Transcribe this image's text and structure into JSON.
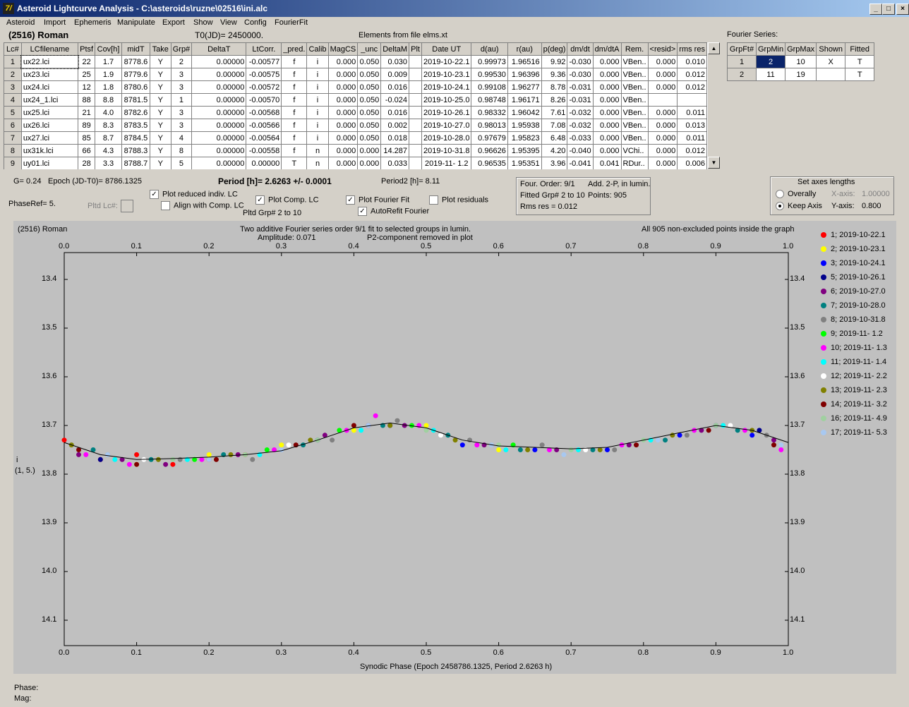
{
  "window": {
    "title": "Asteroid Lightcurve Analysis - C:\\asteroids\\ruzne\\02516\\ini.alc",
    "icon_label": "7/"
  },
  "menu": [
    "Asteroid",
    "Import",
    "Ephemeris",
    "Manipulate",
    "Export",
    "Show",
    "View",
    "Config",
    "FourierFit"
  ],
  "header": {
    "asteroid": "(2516) Roman",
    "t0": "T0(JD)= 2450000.",
    "elements": "Elements from file elms.xt",
    "fourier_title": "Fourier Series:"
  },
  "lc_table": {
    "columns": [
      "Lc#",
      "LCfilename",
      "Ptsf",
      "Cov[h]",
      "midT",
      "Take",
      "Grp#",
      "DeltaT",
      "LtCorr.",
      "_pred.",
      "Calib",
      "MagCS",
      "_unc",
      "DeltaM",
      "Plt",
      "Date UT",
      "d(au)",
      "r(au)",
      "p(deg)",
      "dm/dt",
      "dm/dtA",
      "Rem.",
      "<resid>",
      "rms res"
    ],
    "rows": [
      [
        "1",
        "ux22.lci",
        "22",
        "1.7",
        "8778.6",
        "Y",
        "2",
        "0.00000",
        "-0.00577",
        "f",
        "i",
        "0.000",
        "0.050",
        "0.030",
        "",
        "2019-10-22.1",
        "0.99973",
        "1.96516",
        "9.92",
        "-0.030",
        "0.000",
        "VBen..",
        "0.000",
        "0.010"
      ],
      [
        "2",
        "ux23.lci",
        "25",
        "1.9",
        "8779.6",
        "Y",
        "3",
        "0.00000",
        "-0.00575",
        "f",
        "i",
        "0.000",
        "0.050",
        "0.009",
        "",
        "2019-10-23.1",
        "0.99530",
        "1.96396",
        "9.36",
        "-0.030",
        "0.000",
        "VBen..",
        "0.000",
        "0.012"
      ],
      [
        "3",
        "ux24.lci",
        "12",
        "1.8",
        "8780.6",
        "Y",
        "3",
        "0.00000",
        "-0.00572",
        "f",
        "i",
        "0.000",
        "0.050",
        "0.016",
        "",
        "2019-10-24.1",
        "0.99108",
        "1.96277",
        "8.78",
        "-0.031",
        "0.000",
        "VBen..",
        "0.000",
        "0.012"
      ],
      [
        "4",
        "ux24_1.lci",
        "88",
        "8.8",
        "8781.5",
        "Y",
        "1",
        "0.00000",
        "-0.00570",
        "f",
        "i",
        "0.000",
        "0.050",
        "-0.024",
        "",
        "2019-10-25.0",
        "0.98748",
        "1.96171",
        "8.26",
        "-0.031",
        "0.000",
        "VBen..",
        "",
        ""
      ],
      [
        "5",
        "ux25.lci",
        "21",
        "4.0",
        "8782.6",
        "Y",
        "3",
        "0.00000",
        "-0.00568",
        "f",
        "i",
        "0.000",
        "0.050",
        "0.016",
        "",
        "2019-10-26.1",
        "0.98332",
        "1.96042",
        "7.61",
        "-0.032",
        "0.000",
        "VBen..",
        "0.000",
        "0.011"
      ],
      [
        "6",
        "ux26.lci",
        "89",
        "8.3",
        "8783.5",
        "Y",
        "3",
        "0.00000",
        "-0.00566",
        "f",
        "i",
        "0.000",
        "0.050",
        "0.002",
        "",
        "2019-10-27.0",
        "0.98013",
        "1.95938",
        "7.08",
        "-0.032",
        "0.000",
        "VBen..",
        "0.000",
        "0.013"
      ],
      [
        "7",
        "ux27.lci",
        "85",
        "8.7",
        "8784.5",
        "Y",
        "4",
        "0.00000",
        "-0.00564",
        "f",
        "i",
        "0.000",
        "0.050",
        "0.018",
        "",
        "2019-10-28.0",
        "0.97679",
        "1.95823",
        "6.48",
        "-0.033",
        "0.000",
        "VBen..",
        "0.000",
        "0.011"
      ],
      [
        "8",
        "ux31k.lci",
        "66",
        "4.3",
        "8788.3",
        "Y",
        "8",
        "0.00000",
        "-0.00558",
        "f",
        "n",
        "0.000",
        "0.000",
        "14.287",
        "",
        "2019-10-31.8",
        "0.96626",
        "1.95395",
        "4.20",
        "-0.040",
        "0.000",
        "VChi..",
        "0.000",
        "0.012"
      ],
      [
        "9",
        "uy01.lci",
        "28",
        "3.3",
        "8788.7",
        "Y",
        "5",
        "0.00000",
        "0.00000",
        "T",
        "n",
        "0.000",
        "0.000",
        "0.033",
        "",
        "2019-11- 1.2",
        "0.96535",
        "1.95351",
        "3.96",
        "-0.041",
        "0.041",
        "RDur..",
        "0.000",
        "0.006"
      ]
    ]
  },
  "fourier_table": {
    "columns": [
      "GrpFt#",
      "GrpMin",
      "GrpMax",
      "Shown",
      "Fitted"
    ],
    "rows": [
      [
        "1",
        "2",
        "10",
        "X",
        "T"
      ],
      [
        "2",
        "11",
        "19",
        "",
        "T"
      ]
    ]
  },
  "controls": {
    "g": "G= 0.24",
    "epoch": "Epoch (JD-T0)= 8786.1325",
    "period": "Period [h]= 2.6263 +/- 0.0001",
    "period2": "Period2 [h]= 8.11",
    "phaseref": "PhaseRef= 5.",
    "pltd_lc": "Pltd Lc#:",
    "plot_reduced": "Plot reduced indiv. LC",
    "align_comp": "Align with Comp. LC",
    "plot_comp": "Plot Comp. LC",
    "pltd_grp": "Pltd Grp#  2   to   10",
    "plot_fourier": "Plot Fourier Fit",
    "autorefit": "AutoRefit Fourier",
    "plot_residuals": "Plot residuals",
    "checkbox_mark": "✓"
  },
  "fit_info": {
    "line1a": "Four. Order:  9/1",
    "line1b": "Add. 2-P, in lumin.",
    "line2a": "Fitted Grp# 2 to 10",
    "line2b": "Points: 905",
    "line3": "Rms res      = 0.012"
  },
  "axes_box": {
    "title": "Set axes lengths",
    "overally": "Overally",
    "keep": "Keep Axis",
    "xaxis_label": "X-axis:",
    "xaxis_value": "1.00000",
    "yaxis_label": "Y-axis:",
    "yaxis_value": "0.800"
  },
  "plot": {
    "top_left": "(2516) Roman",
    "title_line1": "Two additive Fourier series order 9/1 fit to selected groups in lumin.",
    "title_line2a": "Amplitude: 0.071",
    "title_line2b": "P2-component removed in plot",
    "top_right": "All 905 non-excluded points inside the graph",
    "ylabel_line1": "i",
    "ylabel_line2": "(1, 5.)",
    "xlabel": "Synodic Phase (Epoch 2458786.1325, Period 2.6263 h)"
  },
  "status": {
    "phase": "Phase:",
    "mag": "Mag:"
  },
  "colors": {
    "plot_bg": "#c0c0c0",
    "title_start": "#0a246a",
    "title_end": "#a6caf0",
    "selected_cell": "#0a246a"
  },
  "chart_data": {
    "type": "scatter",
    "x_ticks": [
      "0.0",
      "0.1",
      "0.2",
      "0.3",
      "0.4",
      "0.5",
      "0.6",
      "0.7",
      "0.8",
      "0.9",
      "1.0"
    ],
    "y_ticks": [
      "13.4",
      "13.5",
      "13.6",
      "13.7",
      "13.8",
      "13.9",
      "14.0",
      "14.1"
    ],
    "xlim": [
      0,
      1
    ],
    "ylim": [
      13.35,
      14.15
    ],
    "y_inverted": true,
    "fit_curve": {
      "x": [
        0.0,
        0.05,
        0.1,
        0.15,
        0.2,
        0.25,
        0.3,
        0.35,
        0.4,
        0.45,
        0.5,
        0.55,
        0.6,
        0.65,
        0.7,
        0.75,
        0.8,
        0.85,
        0.9,
        0.95,
        1.0
      ],
      "y": [
        13.735,
        13.76,
        13.77,
        13.768,
        13.765,
        13.76,
        13.752,
        13.73,
        13.705,
        13.695,
        13.705,
        13.73,
        13.742,
        13.745,
        13.748,
        13.745,
        13.73,
        13.715,
        13.7,
        13.71,
        13.735
      ]
    },
    "series": [
      {
        "name": "1; 2019-10-22.1",
        "color": "#ff0000",
        "x": [
          0.0,
          0.05,
          0.1,
          0.15,
          0.2,
          0.25
        ],
        "y": [
          13.73,
          13.77,
          13.76,
          13.78,
          13.77,
          13.76
        ]
      },
      {
        "name": "2; 2019-10-23.1",
        "color": "#ffff00",
        "x": [
          0.1,
          0.2,
          0.3,
          0.4,
          0.5,
          0.6
        ],
        "y": [
          13.78,
          13.76,
          13.74,
          13.71,
          13.7,
          13.75
        ]
      },
      {
        "name": "3; 2019-10-24.1",
        "color": "#0000ff",
        "x": [
          0.55,
          0.65,
          0.75,
          0.85,
          0.95
        ],
        "y": [
          13.74,
          13.75,
          13.75,
          13.72,
          13.72
        ]
      },
      {
        "name": "5; 2019-10-26.1",
        "color": "#00008b",
        "x": [
          0.05,
          0.35,
          0.45,
          0.9,
          0.96
        ],
        "y": [
          13.77,
          13.73,
          13.7,
          13.7,
          13.71
        ]
      },
      {
        "name": "6; 2019-10-27.0",
        "color": "#800080",
        "x": [
          0.02,
          0.08,
          0.14,
          0.24,
          0.36,
          0.42,
          0.47,
          0.58,
          0.68,
          0.78,
          0.88,
          0.98
        ],
        "y": [
          13.76,
          13.77,
          13.78,
          13.76,
          13.72,
          13.7,
          13.7,
          13.74,
          13.75,
          13.74,
          13.71,
          13.73
        ]
      },
      {
        "name": "7; 2019-10-28.0",
        "color": "#008080",
        "x": [
          0.04,
          0.12,
          0.22,
          0.33,
          0.44,
          0.53,
          0.63,
          0.73,
          0.83,
          0.93
        ],
        "y": [
          13.75,
          13.77,
          13.76,
          13.74,
          13.7,
          13.72,
          13.75,
          13.75,
          13.73,
          13.71
        ]
      },
      {
        "name": "8; 2019-10-31.8",
        "color": "#808080",
        "x": [
          0.06,
          0.16,
          0.26,
          0.37,
          0.46,
          0.56,
          0.66,
          0.76,
          0.86,
          0.97
        ],
        "y": [
          13.76,
          13.77,
          13.77,
          13.73,
          13.69,
          13.73,
          13.74,
          13.75,
          13.72,
          13.72
        ]
      },
      {
        "name": "9; 2019-11- 1.2",
        "color": "#00ff00",
        "x": [
          0.18,
          0.28,
          0.38,
          0.48,
          0.62
        ],
        "y": [
          13.77,
          13.75,
          13.71,
          13.7,
          13.74
        ]
      },
      {
        "name": "10; 2019-11- 1.3",
        "color": "#ff00ff",
        "x": [
          0.03,
          0.09,
          0.19,
          0.29,
          0.39,
          0.43,
          0.49,
          0.57,
          0.67,
          0.77,
          0.87,
          0.94,
          0.99
        ],
        "y": [
          13.76,
          13.78,
          13.77,
          13.75,
          13.71,
          13.68,
          13.7,
          13.74,
          13.75,
          13.74,
          13.71,
          13.71,
          13.75
        ]
      },
      {
        "name": "11; 2019-11- 1.4",
        "color": "#00ffff",
        "x": [
          0.07,
          0.17,
          0.27,
          0.41,
          0.51,
          0.61,
          0.71,
          0.81,
          0.91
        ],
        "y": [
          13.77,
          13.77,
          13.76,
          13.71,
          13.71,
          13.75,
          13.75,
          13.73,
          13.7
        ]
      },
      {
        "name": "12; 2019-11- 2.2",
        "color": "#ffffff",
        "x": [
          0.11,
          0.31,
          0.52,
          0.72,
          0.92
        ],
        "y": [
          13.77,
          13.74,
          13.72,
          13.75,
          13.7
        ]
      },
      {
        "name": "13; 2019-11- 2.3",
        "color": "#808000",
        "x": [
          0.01,
          0.13,
          0.23,
          0.34,
          0.45,
          0.54,
          0.64,
          0.74,
          0.84,
          0.95
        ],
        "y": [
          13.74,
          13.77,
          13.76,
          13.73,
          13.7,
          13.73,
          13.75,
          13.75,
          13.72,
          13.71
        ]
      },
      {
        "name": "14; 2019-11- 3.2",
        "color": "#800000",
        "x": [
          0.02,
          0.1,
          0.21,
          0.32,
          0.4,
          0.79,
          0.89,
          0.98
        ],
        "y": [
          13.75,
          13.78,
          13.77,
          13.74,
          13.7,
          13.74,
          13.71,
          13.74
        ]
      },
      {
        "name": "16; 2019-11- 4.9",
        "color": "#a0d0a0",
        "x": [
          0.15,
          0.25,
          0.35,
          0.5,
          0.6,
          0.7,
          0.8,
          0.9
        ],
        "y": [
          13.77,
          13.76,
          13.73,
          13.71,
          13.74,
          13.75,
          13.73,
          13.7
        ]
      },
      {
        "name": "17; 2019-11- 5.3",
        "color": "#a8c8f0",
        "x": [
          0.06,
          0.2,
          0.3,
          0.42,
          0.59,
          0.69,
          0.82,
          0.99
        ],
        "y": [
          13.76,
          13.77,
          13.75,
          13.7,
          13.74,
          13.76,
          13.73,
          13.74
        ]
      }
    ]
  }
}
